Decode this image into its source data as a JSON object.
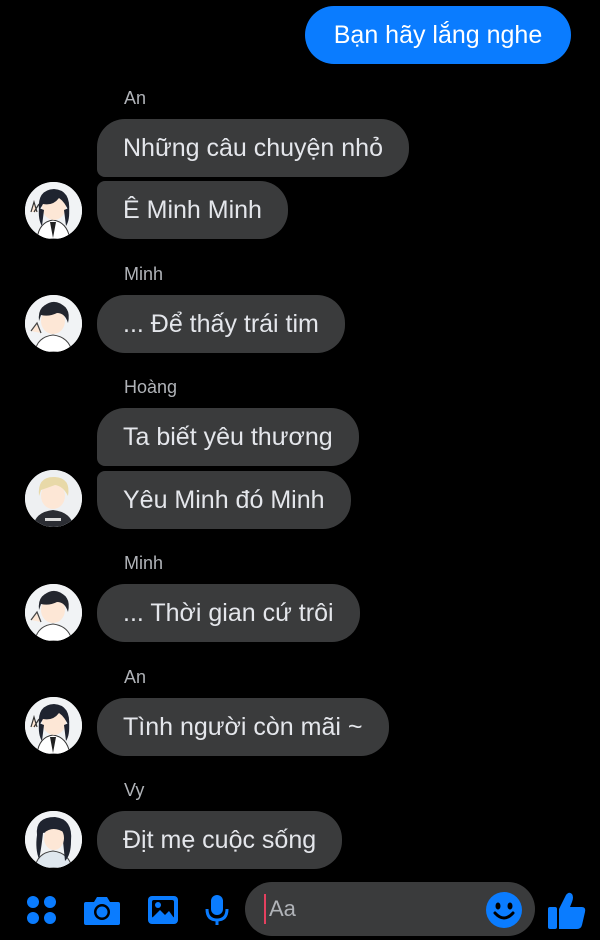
{
  "conversation": {
    "sent": [
      {
        "text": "Bạn hãy lắng nghe"
      }
    ],
    "groups": [
      {
        "sender": "An",
        "avatar": "anime-boy-long-dark-hair-peace-sign",
        "messages": [
          "Những câu chuyện nhỏ",
          "Ê Minh Minh"
        ]
      },
      {
        "sender": "Minh",
        "avatar": "anime-boy-dark-hair",
        "messages": [
          "... Để thấy trái tim"
        ]
      },
      {
        "sender": "Hoàng",
        "avatar": "anime-boy-blonde-hair",
        "messages": [
          "Ta biết yêu thương",
          "Yêu Minh đó Minh"
        ]
      },
      {
        "sender": "Minh",
        "avatar": "anime-boy-dark-hair",
        "messages": [
          "... Thời gian cứ trôi"
        ]
      },
      {
        "sender": "An",
        "avatar": "anime-boy-long-dark-hair-peace-sign",
        "messages": [
          "Tình người còn mãi ~"
        ]
      },
      {
        "sender": "Vy",
        "avatar": "anime-girl-dark-hair",
        "messages": [
          "Địt mẹ cuộc sống"
        ]
      }
    ]
  },
  "composer": {
    "placeholder": "Aa",
    "icons": [
      "menu-dots-icon",
      "camera-icon",
      "image-icon",
      "microphone-icon",
      "emoji-icon",
      "like-icon"
    ]
  },
  "colors": {
    "background": "#000000",
    "received_bubble": "#3a3b3c",
    "sent_bubble": "#0a7cff",
    "accent": "#0a7cff"
  }
}
